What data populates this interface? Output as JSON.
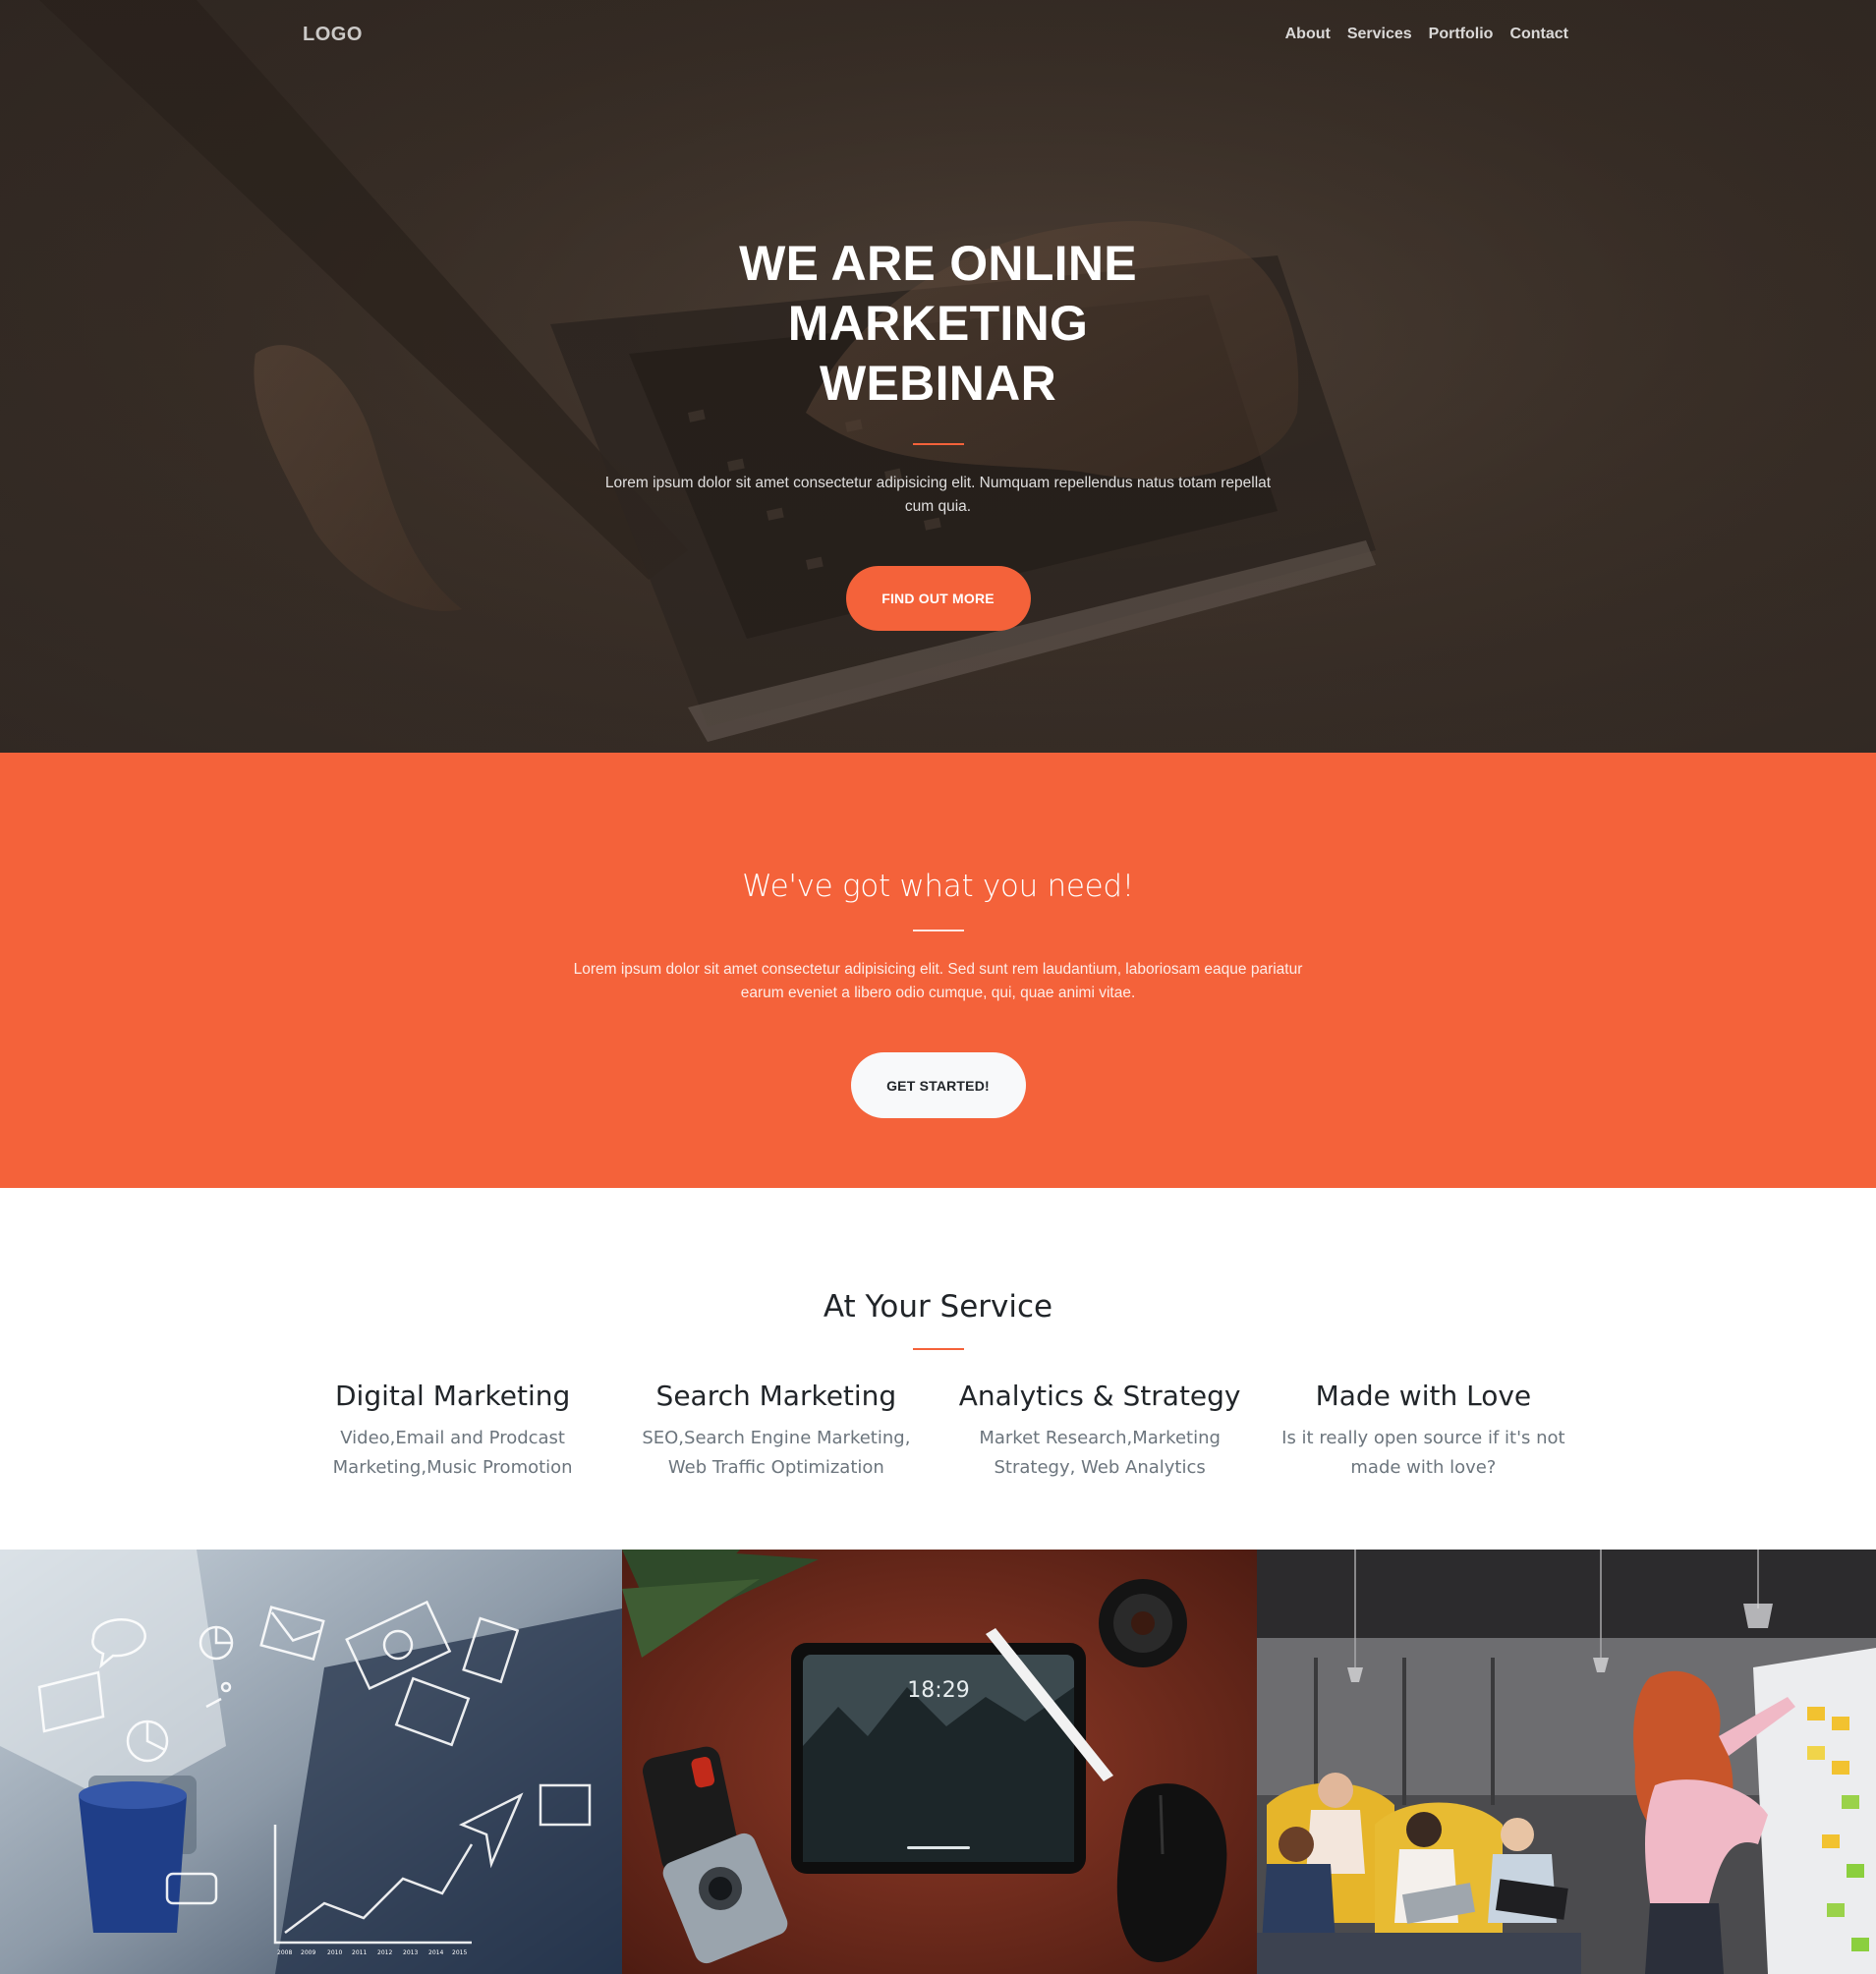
{
  "navbar": {
    "logo": "LOGO",
    "links": [
      "About",
      "Services",
      "Portfolio",
      "Contact"
    ]
  },
  "hero": {
    "title_line1": "WE ARE ONLINE MARKETING",
    "title_line2": "WEBINAR",
    "text": "Lorem ipsum dolor sit amet consectetur adipisicing elit. Numquam repellendus natus totam repellat cum quia.",
    "button": "FIND OUT MORE"
  },
  "need": {
    "title": "We've got what you need!",
    "text": "Lorem ipsum dolor sit amet consectetur adipisicing elit. Sed sunt rem laudantium, laboriosam eaque pariatur earum eveniet a libero odio cumque, qui, quae animi vitae.",
    "button": "GET STARTED!"
  },
  "services": {
    "title": "At Your Service",
    "items": [
      {
        "title": "Digital Marketing",
        "text": "Video,Email and Prodcast Marketing,Music Promotion"
      },
      {
        "title": "Search Marketing",
        "text": "SEO,Search Engine Marketing, Web Traffic Optimization"
      },
      {
        "title": "Analytics & Strategy",
        "text": "Market Research,Marketing Strategy, Web Analytics"
      },
      {
        "title": "Made with Love",
        "text": "Is it really open source if it's not made with love?"
      }
    ]
  },
  "portfolio": {
    "tablet_time": "18:29",
    "chart_years": [
      "2008",
      "2009",
      "2010",
      "2011",
      "2012",
      "2013",
      "2014",
      "2015"
    ]
  },
  "colors": {
    "primary": "#f4623a",
    "dark": "#212529",
    "muted": "#6c757d",
    "hero_bg": "#3a2f28"
  },
  "icons": [
    "laptop-hands-image",
    "marketing-doodle-image",
    "tablet-desk-image",
    "office-meeting-image"
  ]
}
